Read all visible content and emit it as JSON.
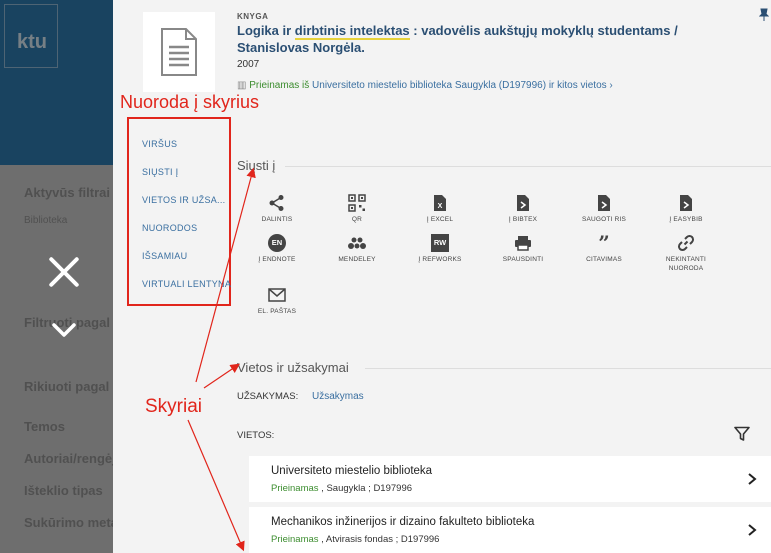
{
  "background": {
    "logo_text": "ktu",
    "filters": [
      "Aktyvūs filtrai",
      "Biblioteka",
      "Filtruoti pagal",
      "Rikiuoti pagal",
      "Temos",
      "Autoriai/rengėjai",
      "Išteklio tipas",
      "Sukūrimo metai"
    ]
  },
  "record": {
    "type": "KNYGA",
    "title_part1": "Logika ir ",
    "title_highlight": "dirbtinis intelektas",
    "title_part2": " : vadovėlis aukštųjų mokyklų studentams / Stanislovas Norgėla.",
    "year": "2007",
    "availability_status": "Prieinamas iš",
    "availability_location": "Universiteto miestelio biblioteka  Saugykla (D197996) ir kitos vietos"
  },
  "annotations": {
    "nav_title": "Nuoroda į skyrius",
    "sections_label": "Skyriai"
  },
  "nav": [
    "VIRŠUS",
    "SIŲSTI Į",
    "VIETOS IR UŽSA...",
    "NUORODOS",
    "IŠSAMIAU",
    "VIRTUALI LENTYNA"
  ],
  "send_to": {
    "title": "Siųsti į",
    "actions": [
      {
        "label": "DALINTIS",
        "icon": "share-icon"
      },
      {
        "label": "QR",
        "icon": "qr-icon"
      },
      {
        "label": "Į EXCEL",
        "icon": "excel-icon"
      },
      {
        "label": "Į BIBTEX",
        "icon": "bibtex-icon"
      },
      {
        "label": "SAUGOTI RIS",
        "icon": "ris-icon"
      },
      {
        "label": "Į EASYBIB",
        "icon": "easybib-icon"
      },
      {
        "label": "Į ENDNOTE",
        "icon": "endnote-icon",
        "badge": "EN"
      },
      {
        "label": "MENDELEY",
        "icon": "mendeley-icon"
      },
      {
        "label": "Į REFWORKS",
        "icon": "refworks-icon",
        "badge": "RW"
      },
      {
        "label": "SPAUSDINTI",
        "icon": "print-icon"
      },
      {
        "label": "CITAVIMAS",
        "icon": "quote-icon"
      },
      {
        "label": "NEKINTANTI NUORODA",
        "icon": "link-icon"
      },
      {
        "label": "EL. PAŠTAS",
        "icon": "email-icon"
      }
    ]
  },
  "locations": {
    "title": "Vietos ir užsakymai",
    "order_label": "UŽSAKYMAS:",
    "order_link": "Užsakymas",
    "places_label": "VIETOS:",
    "items": [
      {
        "name": "Universiteto miestelio biblioteka",
        "status": "Prieinamas",
        "details": " , Saugykla ; D197996"
      },
      {
        "name": "Mechanikos inžinerijos ir dizaino fakulteto biblioteka",
        "status": "Prieinamas",
        "details": " , Atvirasis fondas ; D197996"
      }
    ]
  }
}
